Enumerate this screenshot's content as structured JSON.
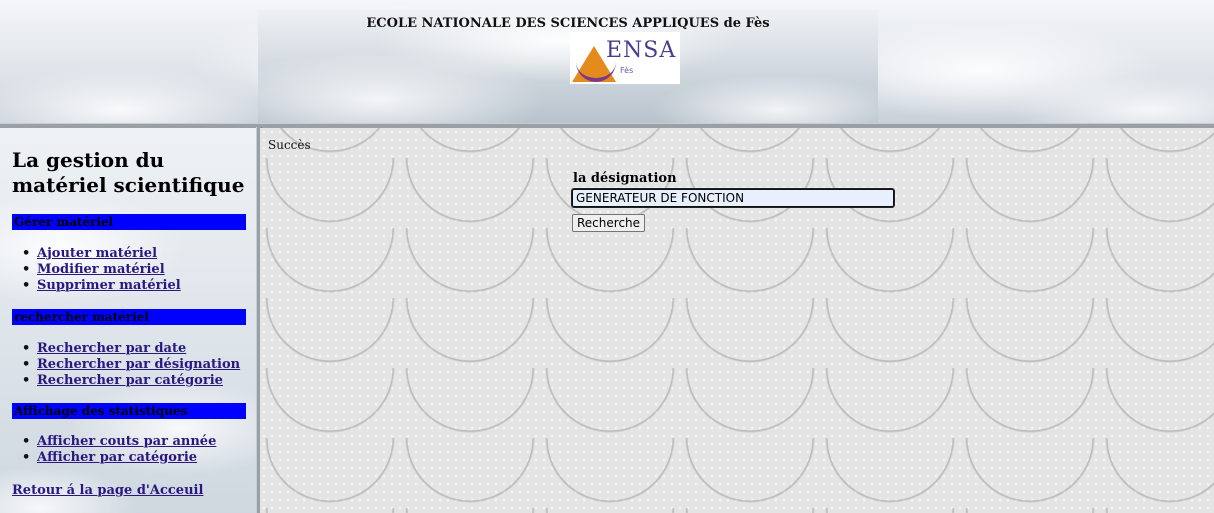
{
  "header": {
    "title": "ECOLE NATIONALE DES SCIENCES APPLIQUES de Fès",
    "logo_text": "ENSA",
    "logo_sub": "Fès"
  },
  "sidebar": {
    "title": "La gestion du matériel scientifique",
    "sections": [
      {
        "heading": "Gérer matériel",
        "items": [
          "Ajouter matériel",
          "Modifier matériel",
          "Supprimer matériel"
        ]
      },
      {
        "heading": "rechercher matériel",
        "items": [
          "Rechercher par date",
          "Rechercher par désignation",
          "Rechercher par catégorie"
        ]
      },
      {
        "heading": "Affichage des statistiques",
        "items": [
          "Afficher couts par année",
          "Afficher par catégorie"
        ]
      }
    ],
    "back_link": "Retour á la page d'Acceuil",
    "accent_color": "#0000ff",
    "link_color": "#2a1780"
  },
  "main": {
    "status": "Succès",
    "field_label": "la désignation",
    "search_value": "GENERATEUR DE FONCTION",
    "button_label": "Recherche"
  }
}
